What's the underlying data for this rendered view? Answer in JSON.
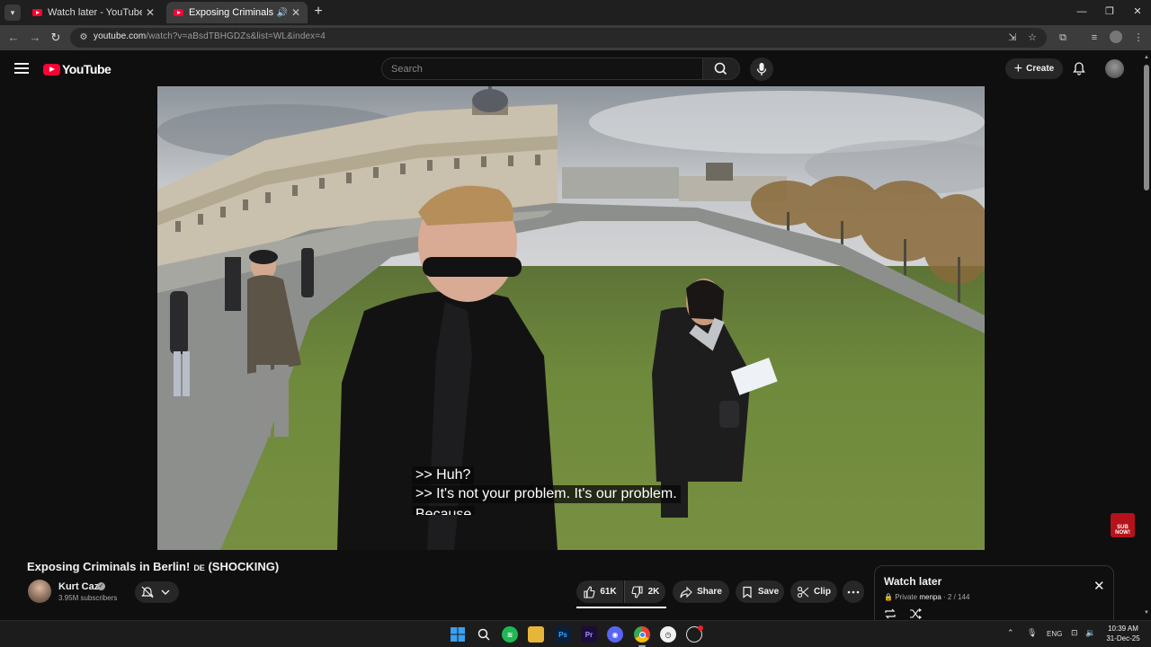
{
  "browser": {
    "tabs": [
      {
        "title": "Watch later - YouTube",
        "active": false
      },
      {
        "title": "Exposing Criminals in Berlin",
        "active": true
      }
    ],
    "url_host": "youtube.com",
    "url_path": "/watch?v=aBsdTBHGDZs&list=WL&index=4"
  },
  "youtube": {
    "logo_text": "YouTube",
    "search_placeholder": "Search",
    "create_label": "Create"
  },
  "video": {
    "captions": [
      ">> Huh?",
      ">> It's not your problem. It's our problem.",
      "Because"
    ],
    "badge_text": "SUB NOW!",
    "title": "Exposing Criminals in Berlin!",
    "title_flag": "DE",
    "title_suffix": "(SHOCKING)",
    "channel_name": "Kurt Caz",
    "subscribers": "3.95M subscribers",
    "likes": "61K",
    "dislikes": "2K",
    "share_label": "Share",
    "save_label": "Save",
    "clip_label": "Clip"
  },
  "playlist": {
    "title": "Watch later",
    "privacy": "Private",
    "owner": "menpa",
    "position": "2 / 144"
  },
  "taskbar": {
    "apps": [
      "start",
      "search",
      "spotify",
      "file-explorer",
      "photoshop",
      "premiere-pro",
      "discord",
      "chrome",
      "clock-app",
      "app-with-badge"
    ],
    "language": "ENG",
    "time": "10:39 AM",
    "date": "31-Dec-25"
  },
  "colors": {
    "yt_red": "#ff0033",
    "page_bg": "#0f0f0f",
    "pill_bg": "#272727"
  }
}
